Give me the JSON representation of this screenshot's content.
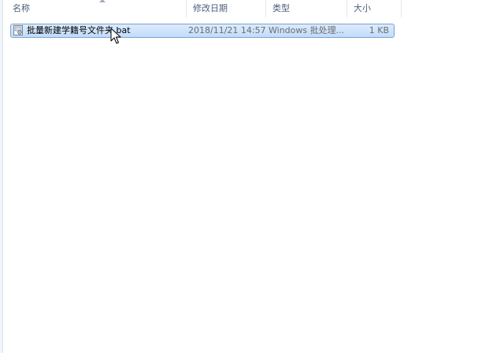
{
  "columns": {
    "name": "名称",
    "date_modified": "修改日期",
    "type": "类型",
    "size": "大小"
  },
  "files": [
    {
      "name": "批量新建学籍号文件夹.bat",
      "date_modified": "2018/11/21 14:57",
      "type": "Windows 批处理...",
      "size": "1 KB",
      "icon": "batch-file-icon",
      "selected": true
    }
  ],
  "cursor": "mouse-pointer-icon"
}
